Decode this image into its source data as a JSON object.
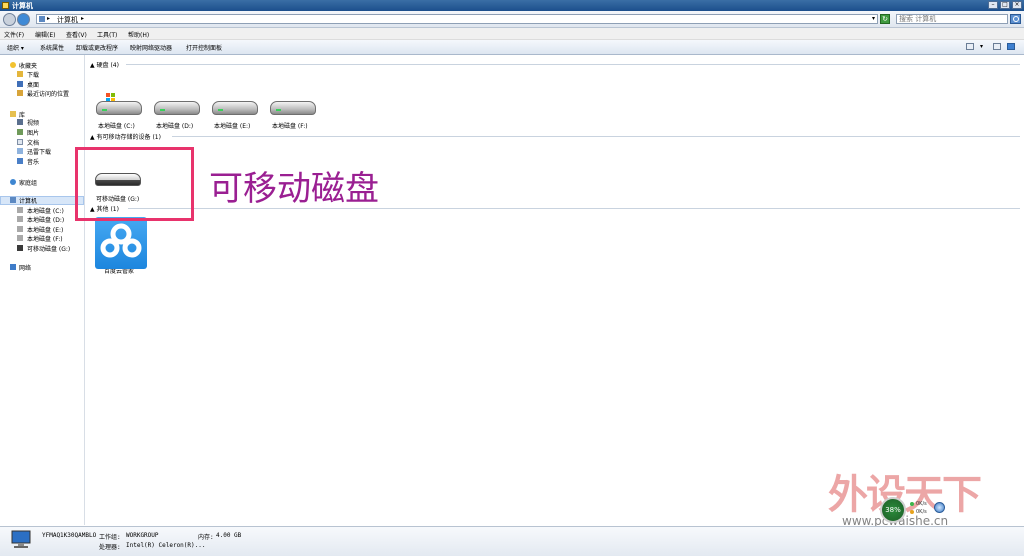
{
  "window": {
    "title": "计算机"
  },
  "address": {
    "path": "计算机",
    "search_placeholder": "搜索 计算机"
  },
  "menu": [
    "文件(F)",
    "编辑(E)",
    "查看(V)",
    "工具(T)",
    "帮助(H)"
  ],
  "toolbar": [
    "组织 ▾",
    "系统属性",
    "卸载或更改程序",
    "映射网络驱动器",
    "打开控制面板"
  ],
  "sidebar": {
    "favorites": {
      "label": "收藏夹",
      "items": [
        "下载",
        "桌面",
        "最近访问的位置"
      ]
    },
    "library": {
      "label": "库",
      "items": [
        "视频",
        "图片",
        "文档",
        "迅雷下载",
        "音乐"
      ]
    },
    "homegroup": "家庭组",
    "computer": {
      "label": "计算机",
      "items": [
        "本地磁盘 (C:)",
        "本地磁盘 (D:)",
        "本地磁盘 (E:)",
        "本地磁盘 (F:)",
        "可移动磁盘 (G:)"
      ]
    },
    "network": "网络"
  },
  "groups": {
    "hdd": {
      "header": "硬盘 (4)",
      "drives": [
        "本地磁盘 (C:)",
        "本地磁盘 (D:)",
        "本地磁盘 (E:)",
        "本地磁盘 (F:)"
      ]
    },
    "removable": {
      "header": "有可移动存储的设备 (1)",
      "drives": [
        "可移动磁盘 (G:)"
      ]
    },
    "other": {
      "header": "其他 (1)",
      "items": [
        "百度云管家"
      ]
    }
  },
  "annotation": "可移动磁盘",
  "status": {
    "computer_name": "YFMAQ1K30QAMBLO",
    "workgroup_label": "工作组:",
    "workgroup": "WORKGROUP",
    "memory_label": "内存:",
    "memory": "4.00 GB",
    "cpu_label": "处理器:",
    "cpu": "Intel(R) Celeron(R)..."
  },
  "tray": {
    "gauge": "38%",
    "up": "0K/s",
    "down": "0K/s"
  },
  "watermark": {
    "text": "外设天下",
    "url": "www.pcwaishe.cn"
  },
  "colors": {
    "annotation": "#9a1f92",
    "highlight_box": "#e8336c",
    "baidu_blue": "#2f97e8"
  }
}
